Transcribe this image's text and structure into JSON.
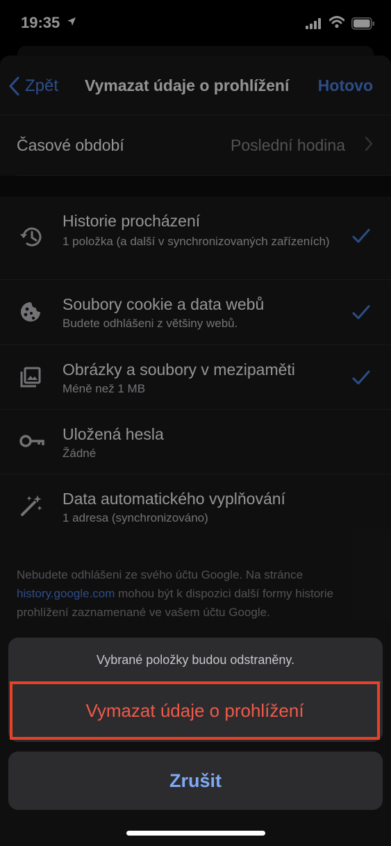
{
  "status_bar": {
    "time": "19:35",
    "icons": [
      "location-arrow-icon",
      "signal-icon",
      "wifi-icon",
      "battery-icon"
    ]
  },
  "nav": {
    "back_label": "Zpět",
    "title": "Vymazat údaje o prohlížení",
    "done_label": "Hotovo"
  },
  "time_range": {
    "label": "Časové období",
    "value": "Poslední hodina"
  },
  "items": [
    {
      "title": "Historie procházení",
      "subtitle": "1 položka (a další v synchronizovaných zařízeních)",
      "icon": "history-icon",
      "checked": true
    },
    {
      "title": "Soubory cookie a data webů",
      "subtitle": "Budete odhlášeni z většiny webů.",
      "icon": "cookie-icon",
      "checked": true
    },
    {
      "title": "Obrázky a soubory v mezipaměti",
      "subtitle": "Méně než 1 MB",
      "icon": "images-icon",
      "checked": true
    },
    {
      "title": "Uložená hesla",
      "subtitle": "Žádné",
      "icon": "key-icon",
      "checked": false
    },
    {
      "title": "Data automatického vyplňování",
      "subtitle": "1 adresa (synchronizováno)",
      "icon": "magic-wand-icon",
      "checked": false
    }
  ],
  "footer": {
    "text_before": "Nebudete odhlášeni ze svého účtu Google. Na stránce ",
    "link": "history.google.com",
    "text_after": " mohou být k dispozici další formy historie prohlížení zaznamenané ve vašem účtu Google."
  },
  "action_sheet": {
    "message": "Vybrané položky budou odstraněny.",
    "destructive_label": "Vymazat údaje o prohlížení",
    "cancel_label": "Zrušit"
  },
  "colors": {
    "accent": "#4f86e8",
    "destructive": "#ef5a4b",
    "highlight_border": "#e8412a",
    "background": "#1b1b1d"
  }
}
